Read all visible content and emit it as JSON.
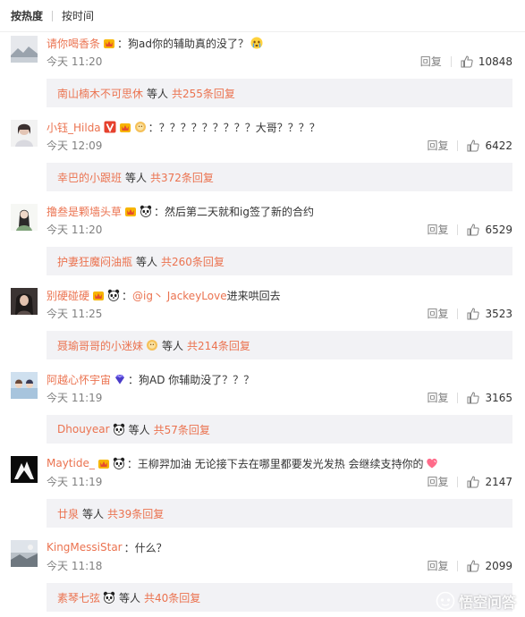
{
  "sort": {
    "hot_label": "按热度",
    "time_label": "按时间"
  },
  "ui": {
    "reply_label": "回复",
    "colon": "：",
    "dengren": "等人"
  },
  "colors": {
    "username": "#eb7350",
    "muted": "#808080",
    "sub_bg": "#f2f2f5"
  },
  "comments": [
    {
      "user": "请你喝香条",
      "badges": [
        "vip-crown-icon"
      ],
      "text": "狗ad你的辅助真的没了？",
      "emoji": "crying-face-emoji",
      "time": "今天 11:20",
      "likes": "10848",
      "sub_user": "南山楠木不可思休",
      "sub_emoji": "",
      "sub_count": "共255条回复"
    },
    {
      "user": "小钰_Hilda",
      "badges": [
        "v-verified-icon",
        "vip-crown-icon",
        "medal-icon"
      ],
      "text": "？？？？？？？？？大哥？？？？",
      "emoji": "",
      "time": "今天 12:09",
      "likes": "6422",
      "sub_user": "幸巴的小跟班",
      "sub_emoji": "",
      "sub_count": "共372条回复"
    },
    {
      "user": "撸叁是颗墙头草",
      "badges": [
        "vip-crown-icon",
        "panda-icon"
      ],
      "text": "然后第二天就和ig签了新的合约",
      "emoji": "",
      "time": "今天 11:20",
      "likes": "6529",
      "sub_user": "护妻狂魔闷油瓶",
      "sub_emoji": "",
      "sub_count": "共260条回复"
    },
    {
      "user": "别硬碰硬",
      "badges": [
        "vip-crown-icon",
        "panda-icon"
      ],
      "mention": "@ig丶 JackeyLove",
      "text": " 进来哄回去",
      "emoji": "",
      "time": "今天 11:25",
      "likes": "3523",
      "sub_user": "聂瑜哥哥的小迷妹",
      "sub_emoji": "medal-icon",
      "sub_count": "共214条回复"
    },
    {
      "user": "阿越心怀宇宙",
      "badges": [
        "diamond-icon"
      ],
      "text": "狗AD 你辅助没了？？？",
      "emoji": "",
      "time": "今天 11:19",
      "likes": "3165",
      "sub_user": "Dhouyear",
      "sub_emoji": "panda-icon",
      "sub_count": "共57条回复"
    },
    {
      "user": "Maytide_",
      "badges": [
        "vip-crown-icon",
        "panda-icon"
      ],
      "text": "王柳羿加油 无论接下去在哪里都要发光发热 会继续支持你的",
      "emoji": "heart-emoji",
      "time": "今天 11:19",
      "likes": "2147",
      "sub_user": "廿泉",
      "sub_emoji": "",
      "sub_count": "共39条回复"
    },
    {
      "user": "KingMessiStar",
      "badges": [],
      "text": "什么？",
      "emoji": "",
      "time": "今天 11:18",
      "likes": "2099",
      "sub_user": "素琴七弦",
      "sub_emoji": "panda-icon",
      "sub_count": "共40条回复"
    }
  ],
  "watermark": {
    "text": "悟空问答"
  }
}
